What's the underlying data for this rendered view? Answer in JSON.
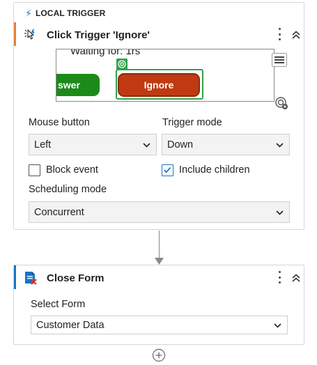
{
  "trigger": {
    "section_title": "LOCAL TRIGGER",
    "activity_title": "Click Trigger 'Ignore'",
    "preview": {
      "waiting_text": "Waiting for: 1rs",
      "answer_button": "swer",
      "ignore_button": "Ignore"
    },
    "mouse_button": {
      "label": "Mouse button",
      "value": "Left"
    },
    "trigger_mode": {
      "label": "Trigger mode",
      "value": "Down"
    },
    "block_event": {
      "label": "Block event",
      "checked": false
    },
    "include_children": {
      "label": "Include children",
      "checked": true
    },
    "scheduling_mode": {
      "label": "Scheduling mode",
      "value": "Concurrent"
    }
  },
  "close_form": {
    "activity_title": "Close Form",
    "select_form": {
      "label": "Select Form",
      "value": "Customer Data"
    }
  },
  "icons": {
    "bolt": "lightning-icon",
    "trigger": "click-trigger-icon",
    "menu": "more-vertical-icon",
    "collapse": "chevron-double-up-icon",
    "hamburger": "menu-icon",
    "target": "target-settings-icon",
    "close_form": "close-form-icon",
    "add": "add-circle-icon"
  },
  "colors": {
    "trigger_accent": "#e8803a",
    "activity_accent": "#1a73c8",
    "answer_green": "#1c8a18",
    "ignore_red": "#bf3a12",
    "highlight_green": "#31a24c"
  }
}
